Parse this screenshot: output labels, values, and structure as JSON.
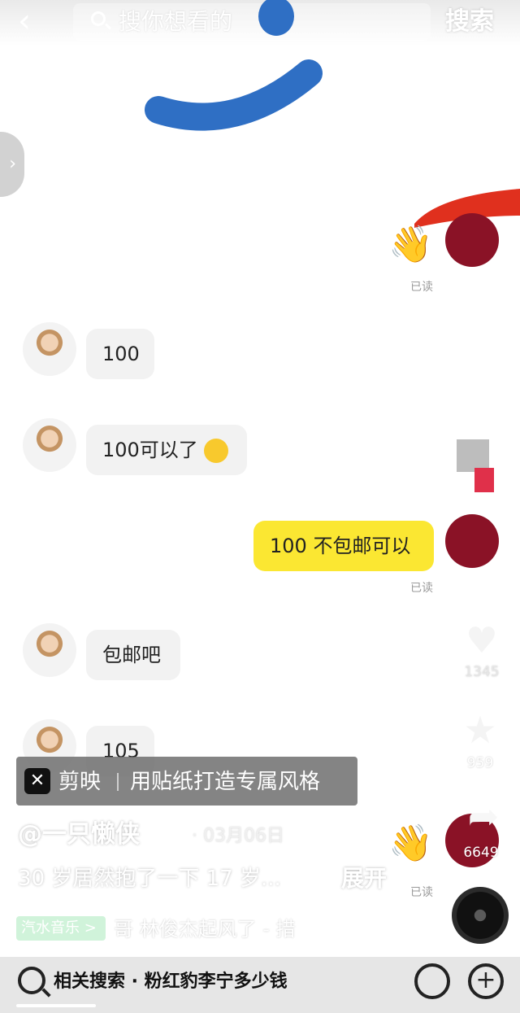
{
  "search": {
    "placeholder": "搜你想看的",
    "button": "搜索"
  },
  "chat": {
    "read_label": "已读",
    "messages": [
      {
        "side": "left",
        "text": "100"
      },
      {
        "side": "left",
        "text": "100可以了"
      },
      {
        "side": "right",
        "text": "100 不包邮可以"
      },
      {
        "side": "left",
        "text": "包邮吧"
      },
      {
        "side": "left",
        "text": "105"
      }
    ]
  },
  "rail": {
    "like_count": "1345",
    "favorite_count": "959",
    "share_count": "6649"
  },
  "promo": {
    "app_name": "剪映",
    "slogan": "用贴纸打造专属风格"
  },
  "post": {
    "author": "@一只懒侠",
    "date": "· 03月06日",
    "description": "30 岁居然抱了一下 17 岁...",
    "expand": "展开"
  },
  "music": {
    "tag": "汽水音乐 >",
    "text": "哥    林俊杰起风了 - 措"
  },
  "bottom": {
    "related_search": "相关搜索 · 粉红豹李宁多少钱"
  },
  "colors": {
    "mine_bubble": "#fbe732",
    "their_bubble": "#f2f2f2",
    "smile_blue": "#2f6fc4",
    "red_stroke": "#e0301e"
  }
}
